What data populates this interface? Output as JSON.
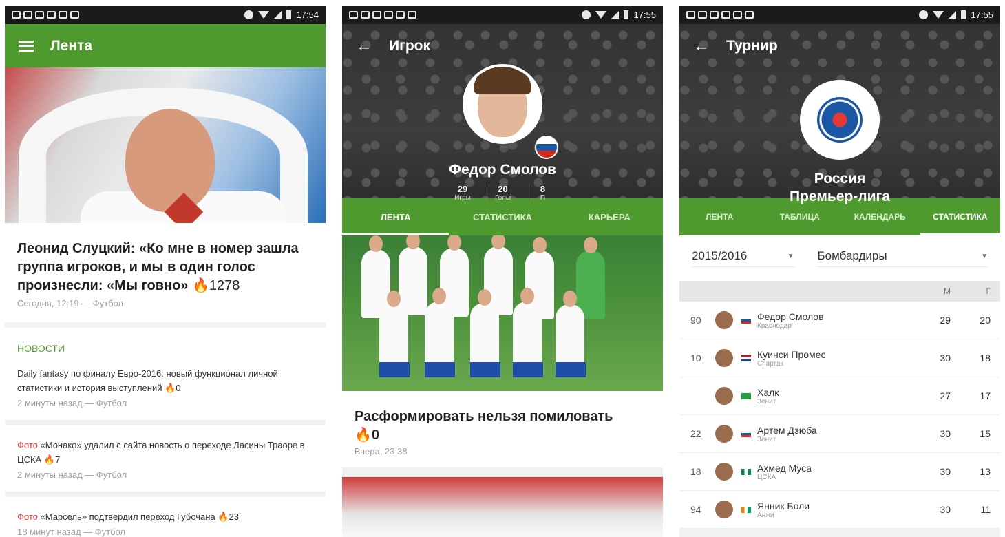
{
  "statusbar": {
    "p1_time": "17:54",
    "p2_time": "17:55",
    "p3_time": "17:55"
  },
  "phone1": {
    "toolbar_title": "Лента",
    "headline": {
      "title": "Леонид Слуцкий: «Ко мне в номер зашла группа игроков, и мы в один голос произнесли: «Мы говно»",
      "count": "1278",
      "meta": "Сегодня, 12:19 — Футбол"
    },
    "section_title": "НОВОСТИ",
    "news": [
      {
        "tag": "",
        "text": "Daily fantasy по финалу Евро-2016: новый функционал личной статистики и история выступлений",
        "count": "0",
        "meta": "2 минуты назад — Футбол"
      },
      {
        "tag": "Фото",
        "text": "«Монако» удалил с сайта новость о переходе Ласины Траоре в ЦСКА",
        "count": "7",
        "meta": "2 минуты назад — Футбол"
      },
      {
        "tag": "Фото",
        "text": "«Марсель» подтвердил переход Губочана",
        "count": "23",
        "meta": "18 минут назад — Футбол"
      }
    ]
  },
  "phone2": {
    "title": "Игрок",
    "player_name": "Федор Смолов",
    "stats": [
      {
        "num": "29",
        "label": "Игры"
      },
      {
        "num": "20",
        "label": "Голы"
      },
      {
        "num": "8",
        "label": "П"
      }
    ],
    "tabs": [
      "ЛЕНТА",
      "СТАТИСТИКА",
      "КАРЬЕРА"
    ],
    "article": {
      "title": "Расформировать нельзя помиловать",
      "count": "0",
      "meta": "Вчера, 23:38"
    }
  },
  "phone3": {
    "title": "Турнир",
    "league_line1": "Россия",
    "league_line2": "Премьер-лига",
    "tabs": [
      "ЛЕНТА",
      "ТАБЛИЦА",
      "КАЛЕНДАРЬ",
      "СТАТИСТИКА"
    ],
    "season": "2015/2016",
    "stat_type": "Бомбардиры",
    "col_m": "М",
    "col_g": "Г",
    "rows": [
      {
        "num": "90",
        "name": "Федор Смолов",
        "club": "Краснодар",
        "m": "29",
        "g": "20",
        "flag": "ru"
      },
      {
        "num": "10",
        "name": "Куинси Промес",
        "club": "Спартак",
        "m": "30",
        "g": "18",
        "flag": "nl"
      },
      {
        "num": "",
        "name": "Халк",
        "club": "Зенит",
        "m": "27",
        "g": "17",
        "flag": "br"
      },
      {
        "num": "22",
        "name": "Артем Дзюба",
        "club": "Зенит",
        "m": "30",
        "g": "15",
        "flag": "ru"
      },
      {
        "num": "18",
        "name": "Ахмед Муса",
        "club": "ЦСКА",
        "m": "30",
        "g": "13",
        "flag": "ng"
      },
      {
        "num": "94",
        "name": "Янник Боли",
        "club": "Анжи",
        "m": "30",
        "g": "11",
        "flag": "ci"
      }
    ]
  },
  "colors": {
    "green": "#4f9a2e",
    "dark": "#333333",
    "fire_red": "#e53935",
    "fire_yellow": "#f5b400"
  }
}
